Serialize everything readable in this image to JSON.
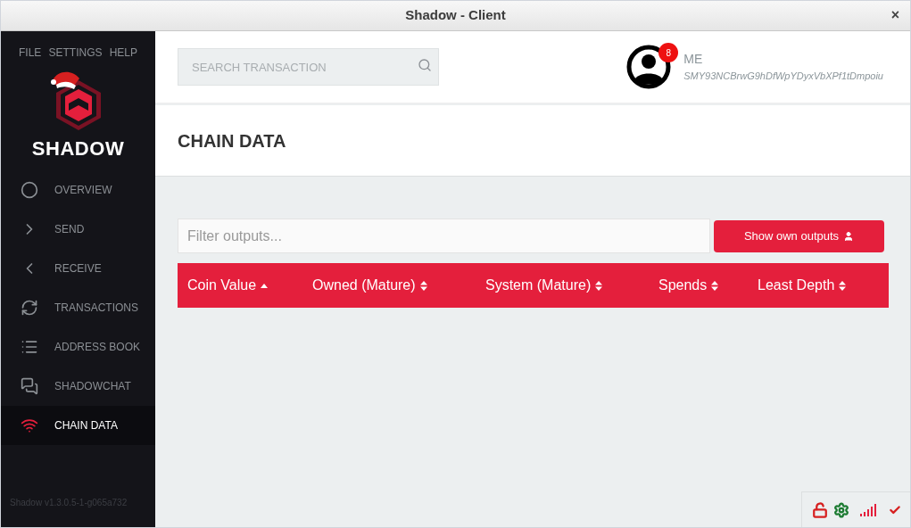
{
  "window": {
    "title": "Shadow - Client",
    "close": "×"
  },
  "menu": [
    "FILE",
    "SETTINGS",
    "HELP"
  ],
  "brand": "SHADOW",
  "nav": [
    {
      "label": "OVERVIEW",
      "kind": "overview",
      "selected": false
    },
    {
      "label": "SEND",
      "kind": "send",
      "selected": false
    },
    {
      "label": "RECEIVE",
      "kind": "receive",
      "selected": false
    },
    {
      "label": "TRANSACTIONS",
      "kind": "transactions",
      "selected": false
    },
    {
      "label": "ADDRESS BOOK",
      "kind": "addressbook",
      "selected": false
    },
    {
      "label": "SHADOWCHAT",
      "kind": "chat",
      "selected": false
    },
    {
      "label": "CHAIN DATA",
      "kind": "chaindata",
      "selected": true
    }
  ],
  "version": "Shadow v1.3.0.5-1-g065a732",
  "search": {
    "placeholder": "SEARCH TRANSACTION"
  },
  "user": {
    "name": "ME",
    "address": "SMY93NCBrwG9hDfWpYDyxVbXPf1tDmpoiu",
    "badge": "8"
  },
  "page_title": "CHAIN DATA",
  "filter": {
    "placeholder": "Filter outputs..."
  },
  "own_outputs_button": "Show own outputs",
  "table": {
    "columns": [
      {
        "label": "Coin Value",
        "sorted": true
      },
      {
        "label": "Owned (Mature)",
        "sorted": false
      },
      {
        "label": "System (Mature)",
        "sorted": false
      },
      {
        "label": "Spends",
        "sorted": false
      },
      {
        "label": "Least Depth",
        "sorted": false
      }
    ]
  },
  "status_bar": {
    "locked": false
  }
}
